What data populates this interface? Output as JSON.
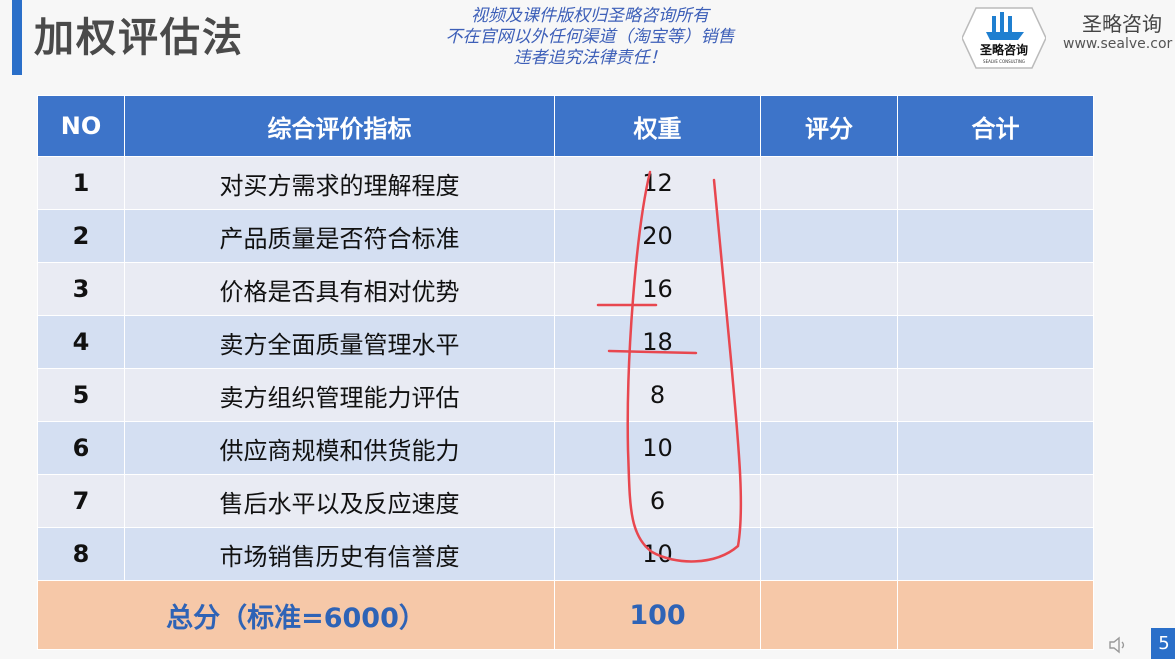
{
  "slide": {
    "title": "加权评估法",
    "copyright_lines": [
      "视频及课件版权归圣略咨询所有",
      "不在官网以外任何渠道（淘宝等）销售",
      "违者追究法律责任！"
    ],
    "page_number": "5"
  },
  "logo": {
    "mark_text": "圣略咨询",
    "mark_subtext": "SEALVE CONSULTING",
    "brand_name": "圣略咨询",
    "url": "www.sealve.cor"
  },
  "table": {
    "headers": [
      "NO",
      "综合评价指标",
      "权重",
      "评分",
      "合计"
    ],
    "rows": [
      {
        "no": "1",
        "indicator": "对买方需求的理解程度",
        "weight": "12",
        "score": "",
        "total": ""
      },
      {
        "no": "2",
        "indicator": "产品质量是否符合标准",
        "weight": "20",
        "score": "",
        "total": ""
      },
      {
        "no": "3",
        "indicator": "价格是否具有相对优势",
        "weight": "16",
        "score": "",
        "total": ""
      },
      {
        "no": "4",
        "indicator": "卖方全面质量管理水平",
        "weight": "18",
        "score": "",
        "total": ""
      },
      {
        "no": "5",
        "indicator": "卖方组织管理能力评估",
        "weight": "8",
        "score": "",
        "total": ""
      },
      {
        "no": "6",
        "indicator": "供应商规模和供货能力",
        "weight": "10",
        "score": "",
        "total": ""
      },
      {
        "no": "7",
        "indicator": "售后水平以及反应速度",
        "weight": "6",
        "score": "",
        "total": ""
      },
      {
        "no": "8",
        "indicator": "市场销售历史有信誉度",
        "weight": "10",
        "score": "",
        "total": ""
      }
    ],
    "footer": {
      "label": "总分（标准=6000）",
      "weight": "100",
      "score": "",
      "total": ""
    }
  },
  "colors": {
    "header_bg": "#3d74c9",
    "row_odd": "#e9ebf3",
    "row_even": "#d4dff2",
    "footer_bg": "#f6c8a8",
    "footer_text": "#2e63b6",
    "annotation": "#e8474f",
    "accent": "#2a6fc9"
  },
  "icons": [
    "ship-logo-icon",
    "speaker-icon"
  ]
}
